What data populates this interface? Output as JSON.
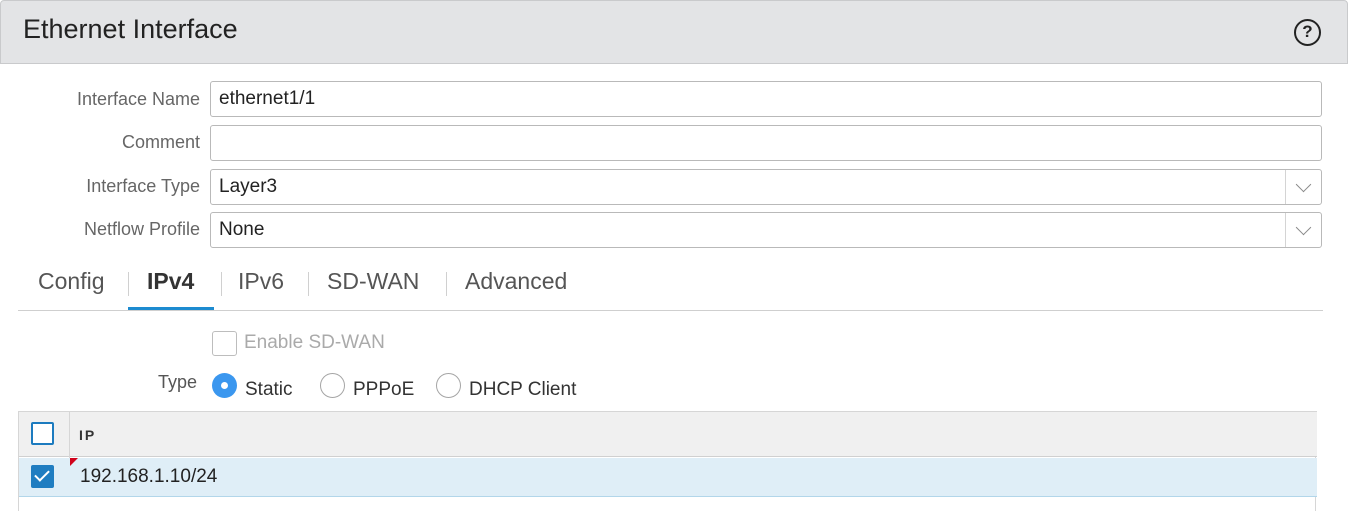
{
  "window": {
    "title": "Ethernet Interface",
    "help_icon": "?"
  },
  "fields": {
    "interface_name": {
      "label": "Interface Name",
      "value": "ethernet1/1"
    },
    "comment": {
      "label": "Comment",
      "value": ""
    },
    "interface_type": {
      "label": "Interface Type",
      "value": "Layer3"
    },
    "netflow_profile": {
      "label": "Netflow Profile",
      "value": "None"
    }
  },
  "tabs": [
    {
      "label": "Config"
    },
    {
      "label": "IPv4"
    },
    {
      "label": "IPv6"
    },
    {
      "label": "SD-WAN"
    },
    {
      "label": "Advanced"
    }
  ],
  "active_tab": "IPv4",
  "ipv4": {
    "enable_sdwan": {
      "label": "Enable SD-WAN",
      "checked": false,
      "disabled": true
    },
    "type_label": "Type",
    "type_options": [
      {
        "label": "Static",
        "selected": true
      },
      {
        "label": "PPPoE",
        "selected": false
      },
      {
        "label": "DHCP Client",
        "selected": false
      }
    ],
    "grid": {
      "header": "IP",
      "rows": [
        {
          "ip": "192.168.1.10/24",
          "checked": true
        }
      ]
    }
  },
  "colors": {
    "accent": "#1d8bd0",
    "radio_selected": "#3b97ef",
    "row_selected": "#dfeef7",
    "checkbox_checked": "#1f7dc1",
    "title_bar": "#e3e4e6"
  }
}
